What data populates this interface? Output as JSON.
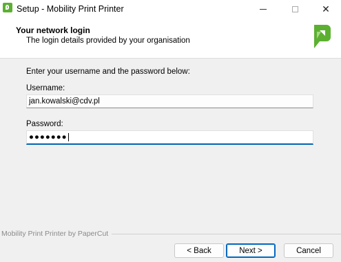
{
  "window": {
    "title": "Setup - Mobility Print Printer",
    "close_glyph": "✕"
  },
  "header": {
    "title": "Your network login",
    "subtitle": "The login details provided by your organisation"
  },
  "form": {
    "instruction": "Enter your username and the password below:",
    "username_label": "Username:",
    "username_value": "jan.kowalski@cdv.pl",
    "password_label": "Password:",
    "password_value": "●●●●●●●"
  },
  "footer": {
    "brand": "Mobility Print Printer by PaperCut",
    "back_label": "< Back",
    "next_label": "Next >",
    "cancel_label": "Cancel"
  },
  "colors": {
    "brand_green": "#5cb031",
    "focus_blue": "#0063b1"
  }
}
